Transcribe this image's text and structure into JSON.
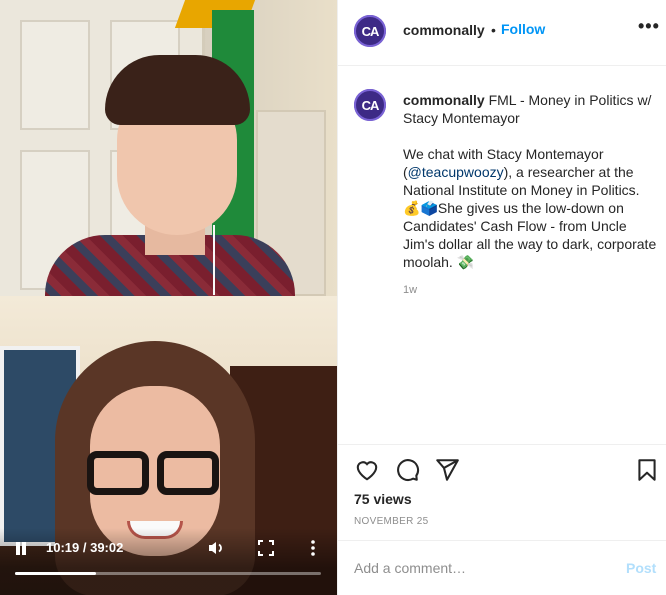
{
  "video": {
    "current_time": "10:19",
    "separator": " / ",
    "duration": "39:02",
    "progress_fraction": 0.264,
    "state": "playing"
  },
  "header": {
    "avatar_initials": "CA",
    "username": "commonally",
    "separator": "•",
    "follow_label": "Follow",
    "more_label": "•••"
  },
  "caption": {
    "username": "commonally",
    "title": "FML - Money in Politics w/ Stacy Montemayor",
    "body_before_mention": "We chat with Stacy Montemayor (",
    "mention": "@teacupwoozy",
    "body_after_mention": "), a researcher at the National Institute on Money in Politics.",
    "emoji_bag": "💰",
    "emoji_ballot": "🗳️",
    "body_2": "She gives us the low-down on Candidates' Cash Flow - from Uncle Jim's dollar all the way to dark, corporate moolah.",
    "emoji_money": "💸",
    "time_ago": "1w"
  },
  "stats": {
    "views": "75 views",
    "date": "NOVEMBER 25"
  },
  "comment": {
    "placeholder": "Add a comment…",
    "post_label": "Post"
  },
  "colors": {
    "accent": "#0095f6",
    "avatar_bg": "#3d2a86",
    "post_disabled": "#b2dffc"
  }
}
